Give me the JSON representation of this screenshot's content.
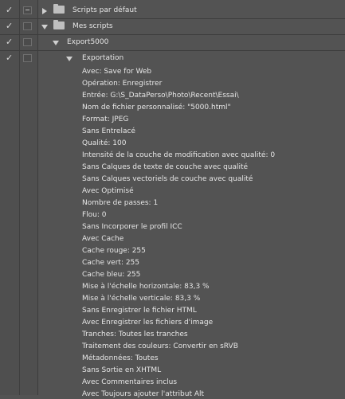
{
  "rows": [
    {
      "label": "Scripts par défaut"
    },
    {
      "label": "Mes scripts"
    },
    {
      "label": "Export5000"
    },
    {
      "label": "Exportation"
    }
  ],
  "params": [
    "Avec: Save for Web",
    "Opération: Enregistrer",
    "Entrée: G:\\S_DataPerso\\Photo\\Recent\\Essai\\",
    "Nom de fichier personnalisé:  \"5000.html\"",
    "Format: JPEG",
    "Sans Entrelacé",
    "Qualité: 100",
    "Intensité de la couche de modification avec qualité: 0",
    "Sans Calques de texte de couche avec qualité",
    "Sans Calques vectoriels de couche avec qualité",
    "Avec Optimisé",
    "Nombre de passes: 1",
    "Flou: 0",
    "Sans Incorporer le profil ICC",
    "Avec Cache",
    "Cache rouge: 255",
    "Cache vert: 255",
    "Cache bleu: 255",
    "Mise à l'échelle horizontale: 83,3 %",
    "Mise à l'échelle verticale: 83,3 %",
    "Sans Enregistrer le fichier HTML",
    "Avec Enregistrer les fichiers d'image",
    "Tranches: Toutes les tranches",
    "Traitement des couleurs: Convertir en sRVB",
    "Métadonnées: Toutes",
    "Sans Sortie en XHTML",
    "Avec Commentaires inclus",
    "Avec Toujours ajouter l'attribut Alt"
  ]
}
